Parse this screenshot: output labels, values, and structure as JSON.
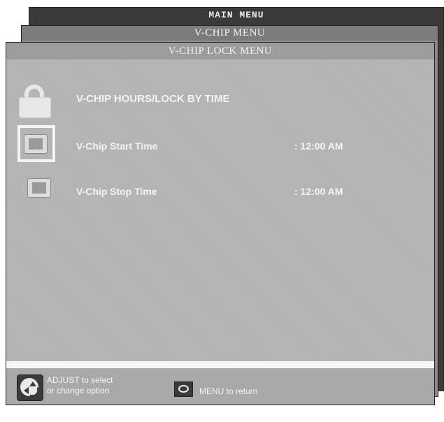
{
  "main_menu": {
    "title": "MAIN MENU"
  },
  "vchip_menu": {
    "title": "V-CHIP MENU"
  },
  "lock_menu": {
    "title": "V-CHIP LOCK MENU",
    "heading": "V-CHIP HOURS/LOCK BY TIME",
    "rows": [
      {
        "label": "V-Chip Start Time",
        "value": ": 12:00 AM",
        "selected": true,
        "icon": "clock-icon"
      },
      {
        "label": "V-Chip Stop Time",
        "value": ": 12:00 AM",
        "selected": false,
        "icon": "clock-icon"
      }
    ],
    "heading_icon": "lock-icon"
  },
  "footer": {
    "adjust_line1": "ADJUST to select",
    "adjust_line2": "or change option",
    "menu_hint": "MENU to return",
    "adjust_icon": "dpad-icon",
    "menu_icon": "menu-button-icon"
  }
}
